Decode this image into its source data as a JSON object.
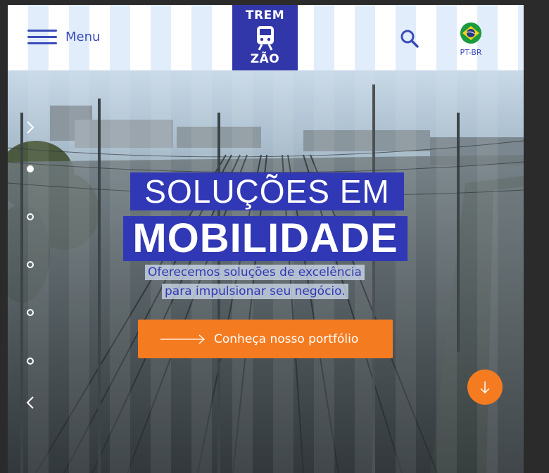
{
  "header": {
    "menu_label": "Menu",
    "logo_top": "TREM",
    "logo_bottom": "ZÃO",
    "language": "PT-BR"
  },
  "hero": {
    "headline_line1": "SOLUÇÕES EM",
    "headline_line2": "MOBILIDADE",
    "subtitle_line1": "Oferecemos soluções de excelência",
    "subtitle_line2": "para impulsionar seu negócio.",
    "cta_label": "Conheça nosso portfólio",
    "slides": 5,
    "active_slide": 1
  },
  "colors": {
    "brand_blue": "#3138b5",
    "accent_orange": "#f57b21",
    "header_stripe": "#e2edfb"
  },
  "icons": [
    "hamburger-icon",
    "train-icon",
    "search-icon",
    "brazil-flag-icon",
    "chevron-right-icon",
    "chevron-left-icon",
    "arrow-right-icon",
    "arrow-down-icon"
  ]
}
